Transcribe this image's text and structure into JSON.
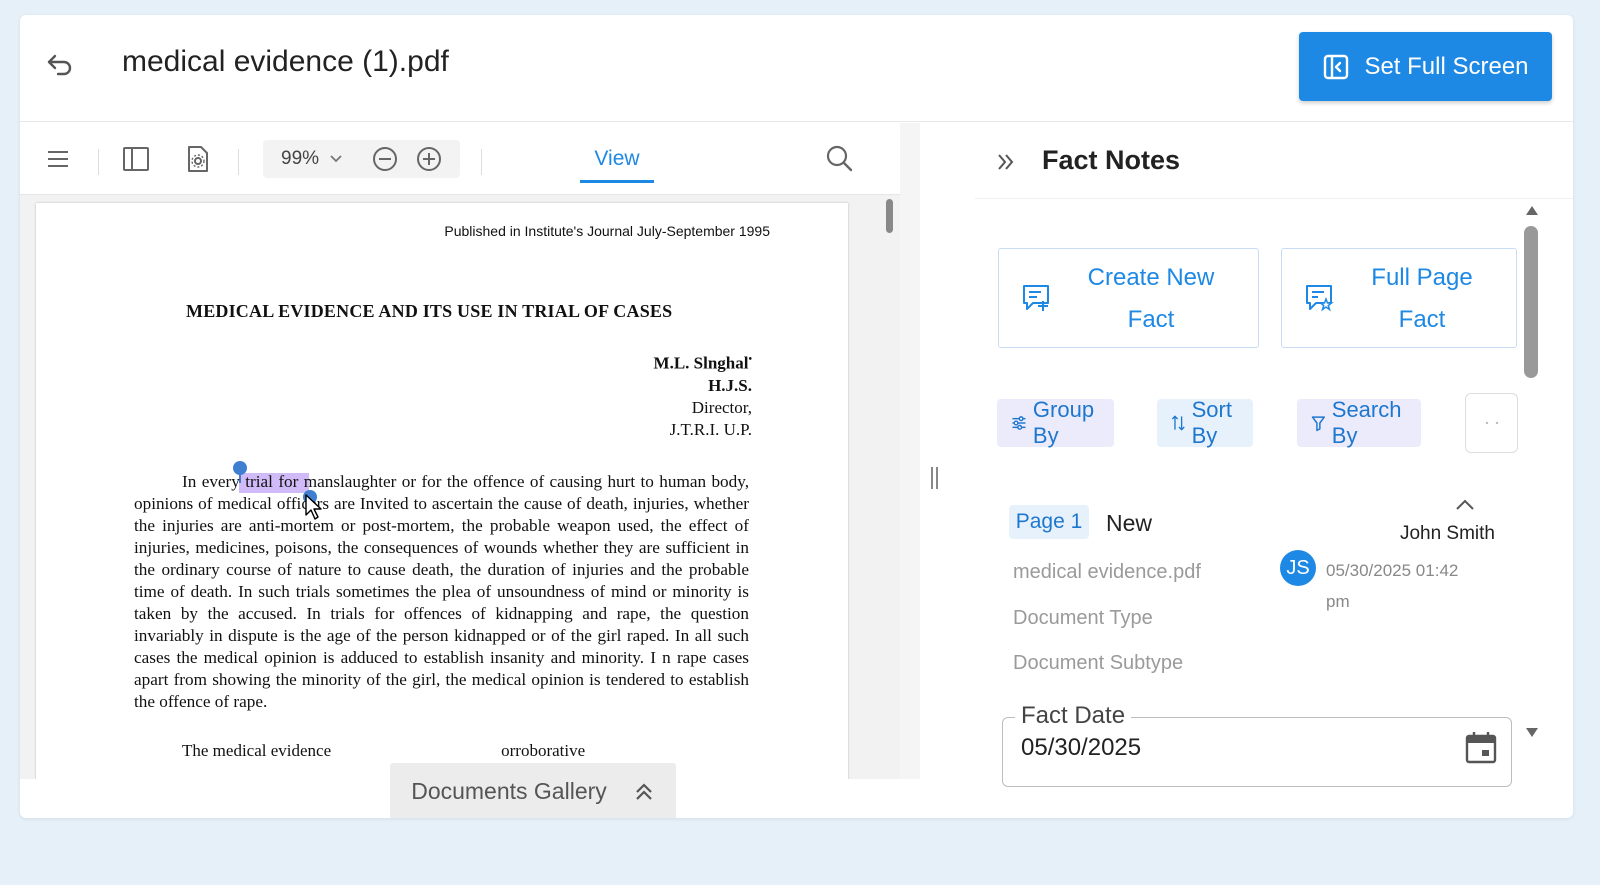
{
  "header": {
    "title": "medical evidence (1).pdf",
    "fullscreen_label": "Set Full Screen"
  },
  "viewer": {
    "zoom": "99%",
    "view_tab": "View",
    "gallery_label": "Documents Gallery"
  },
  "document": {
    "published": "Published in Institute's Journal July-September 1995",
    "title": "MEDICAL EVIDENCE AND ITS USE IN TRIAL OF CASES",
    "author_line1": "M.L. Slnghal",
    "author_mark": "•",
    "author_line2": "H.J.S.",
    "author_line3": "Director,",
    "author_line4": "J.T.R.I. U.P.",
    "paragraph": "In every trial for manslaughter or for the offence of causing hurt to human body, opinions of medical officers are Invited to ascertain the cause of death, injuries, whether the injuries are anti-mortem or post-mortem, the probable weapon used, the effect of injuries, medicines, poisons, the consequences of wounds whether they are sufficient in the ordinary course of nature to cause death, the duration of injuries and the probable time of death. In such trials sometimes the plea of unsoundness of mind or minority is taken by the accused. In trials for offences of kidnapping and rape, the question invariably in dispute is the age of the person kidnapped or of the girl raped. In all such cases the medical opinion is adduced to establish insanity and minority. I n rape cases apart from showing the minority of the girl, the medical opinion is tendered to establish the offence of rape.",
    "next_line": "The medical evidence                                        orroborative"
  },
  "panel": {
    "title": "Fact Notes",
    "create_label_1": "Create New",
    "create_label_2": "Fact",
    "fullpage_label_1": "Full Page",
    "fullpage_label_2": "Fact",
    "group_by": "Group By",
    "sort_by": "Sort By",
    "search_by": "Search By"
  },
  "fact": {
    "page": "Page 1",
    "status": "New",
    "user": "John Smith",
    "avatar_initials": "JS",
    "timestamp_1": "05/30/2025 01:42",
    "timestamp_2": "pm",
    "file": "medical evidence.pdf",
    "doc_type": "Document Type",
    "doc_subtype": "Document Subtype",
    "date_label": "Fact Date",
    "date_value": "05/30/2025"
  },
  "colors": {
    "accent": "#1e88e5",
    "highlight": "#aa82f0",
    "background": "#e6f0f8"
  }
}
